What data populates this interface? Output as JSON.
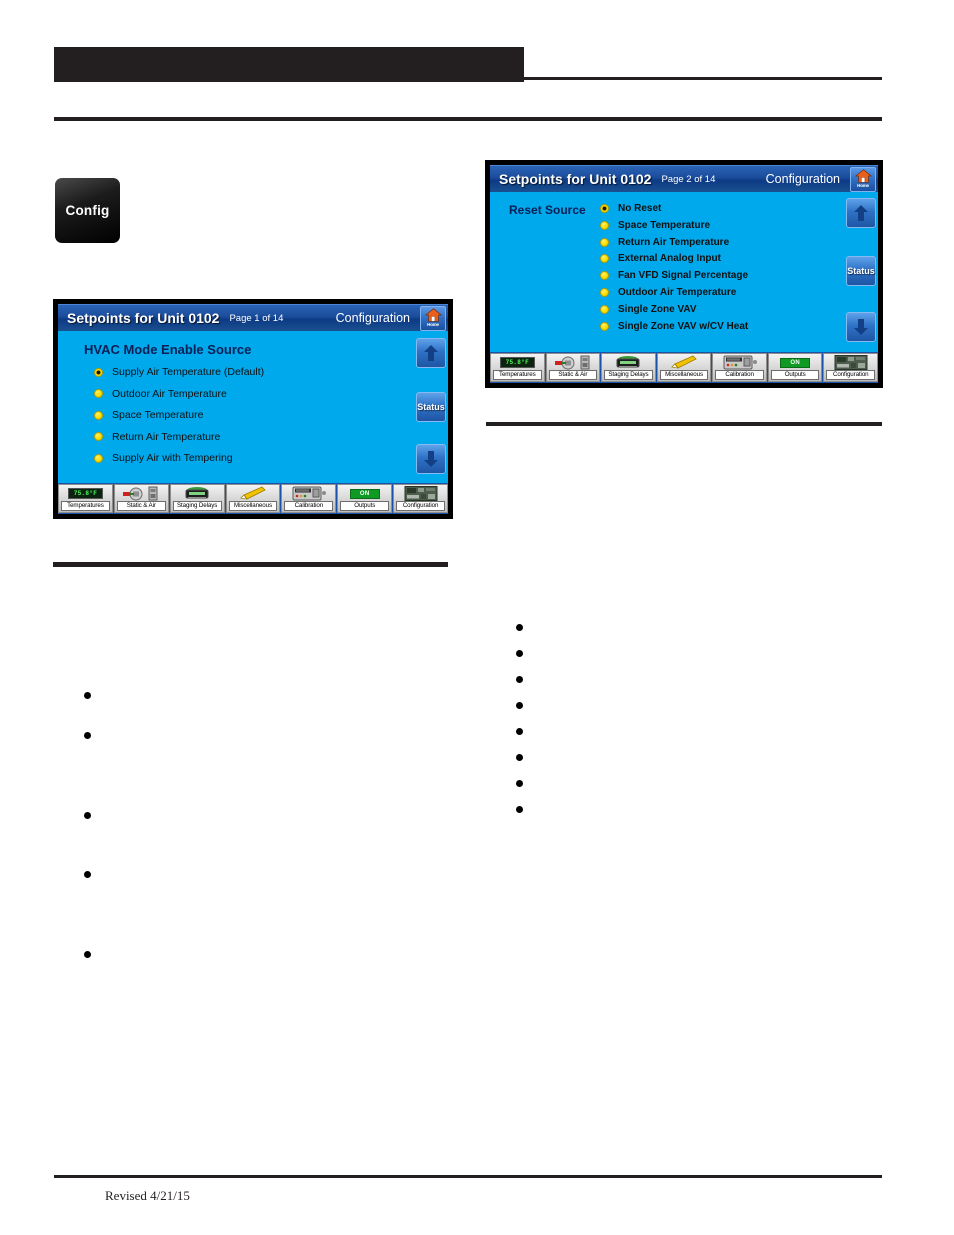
{
  "document": {
    "footer_note": "Revised 4/21/15",
    "config_chip_label": "Config"
  },
  "panels": [
    {
      "id": "panel-setpoints-page1",
      "header": {
        "title": "Setpoints for Unit 0102",
        "page": "Page 1 of 14",
        "section": "Configuration",
        "home_button_label": "Home",
        "home_icon": "home-icon"
      },
      "content": {
        "heading": "HVAC Mode Enable Source",
        "heading_style": "block",
        "options": [
          {
            "label": "Supply Air Temperature (Default)",
            "selected": true
          },
          {
            "label": "Outdoor Air Temperature",
            "selected": false
          },
          {
            "label": "Space Temperature",
            "selected": false
          },
          {
            "label": "Return Air Temperature",
            "selected": false
          },
          {
            "label": "Supply Air with Tempering",
            "selected": false
          }
        ]
      },
      "nav": {
        "up_icon": "arrow-up-icon",
        "status_label": "Status",
        "down_icon": "arrow-down-icon"
      },
      "toolbar": [
        {
          "label": "Temperatures",
          "icon": "thermometer-display-icon",
          "value": "75.8°F"
        },
        {
          "label": "Static & Air",
          "icon": "static-pressure-icon"
        },
        {
          "label": "Staging Delays",
          "icon": "staging-delays-icon"
        },
        {
          "label": "Miscellaneous",
          "icon": "pencil-tool-icon"
        },
        {
          "label": "Calibration",
          "icon": "meter-icon"
        },
        {
          "label": "Outputs",
          "icon": "on-indicator-icon",
          "value": "ON"
        },
        {
          "label": "Configuration",
          "icon": "circuit-board-icon"
        }
      ]
    },
    {
      "id": "panel-setpoints-page2",
      "header": {
        "title": "Setpoints for Unit 0102",
        "page": "Page 2 of 14",
        "section": "Configuration",
        "home_button_label": "Home",
        "home_icon": "home-icon"
      },
      "content": {
        "heading": "Reset Source",
        "heading_style": "inline",
        "options": [
          {
            "label": "No Reset",
            "selected": true
          },
          {
            "label": "Space Temperature",
            "selected": false
          },
          {
            "label": "Return Air Temperature",
            "selected": false
          },
          {
            "label": "External Analog Input",
            "selected": false
          },
          {
            "label": "Fan VFD Signal Percentage",
            "selected": false
          },
          {
            "label": "Outdoor Air Temperature",
            "selected": false
          },
          {
            "label": "Single Zone VAV",
            "selected": false
          },
          {
            "label": "Single Zone VAV w/CV Heat",
            "selected": false
          }
        ]
      },
      "nav": {
        "up_icon": "arrow-up-icon",
        "status_label": "Status",
        "down_icon": "arrow-down-icon"
      },
      "toolbar": [
        {
          "label": "Temperatures",
          "icon": "thermometer-display-icon",
          "value": "75.8°F"
        },
        {
          "label": "Static & Air",
          "icon": "static-pressure-icon"
        },
        {
          "label": "Staging Delays",
          "icon": "staging-delays-icon"
        },
        {
          "label": "Miscellaneous",
          "icon": "pencil-tool-icon"
        },
        {
          "label": "Calibration",
          "icon": "meter-icon"
        },
        {
          "label": "Outputs",
          "icon": "on-indicator-icon",
          "value": "ON"
        },
        {
          "label": "Configuration",
          "icon": "circuit-board-icon"
        }
      ]
    }
  ],
  "bullet_lists": {
    "left": {
      "count": 5,
      "offsets": [
        0,
        40,
        120,
        179,
        259
      ]
    },
    "right": {
      "count": 8,
      "offsets": [
        0,
        26,
        52,
        78,
        104,
        130,
        156,
        182
      ]
    }
  },
  "colors": {
    "panel_body": "#00a8ec",
    "header_blue": "#1b4c9c",
    "radio_yellow": "#fbdf00",
    "ink": "#231f20",
    "heading_navy": "#0a1f55",
    "lcd_green": "#4cff5a",
    "on_green": "#0f9a23"
  }
}
